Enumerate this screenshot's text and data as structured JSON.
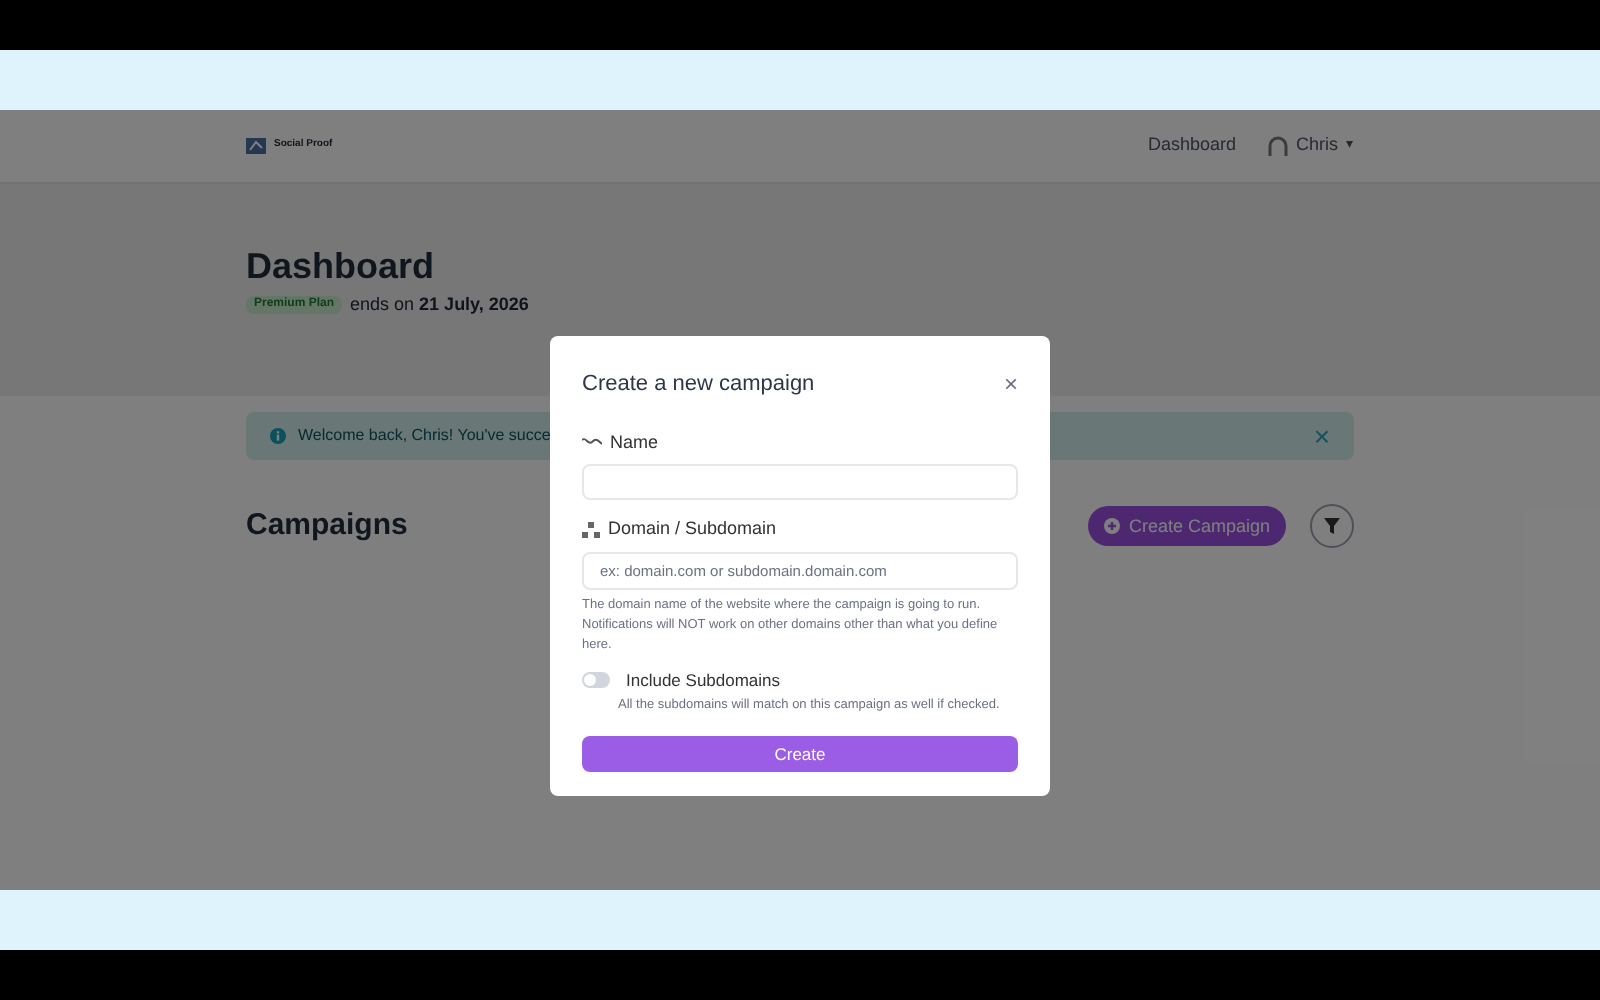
{
  "navbar": {
    "logo_text": "Social Proof",
    "links": [
      {
        "label": "Dashboard"
      }
    ],
    "user": {
      "name": "Chris",
      "caret": "▾"
    }
  },
  "header": {
    "title": "Dashboard",
    "plan_badge": "Premium Plan",
    "plan_text": "ends on **21 July, 2026**"
  },
  "alert": {
    "text": "Welcome back, Chris! You've succe",
    "close": "×"
  },
  "campaigns": {
    "title": "Campaigns",
    "create_button": "Create Campaign"
  },
  "modal": {
    "title": "Create a new campaign",
    "close": "×",
    "name_field": {
      "label": "Name"
    },
    "domain_field": {
      "label": "Domain / Subdomain",
      "placeholder": "ex: domain.com or subdomain.domain.com",
      "help": "The domain name of the website where the campaign is going to run. Notifications will NOT work on other domains other than what you define here."
    },
    "include_subdomains": {
      "label": "Include Subdomains",
      "on": false,
      "help": "All the subdomains will match on this campaign as well if checked."
    },
    "submit": "Create"
  }
}
